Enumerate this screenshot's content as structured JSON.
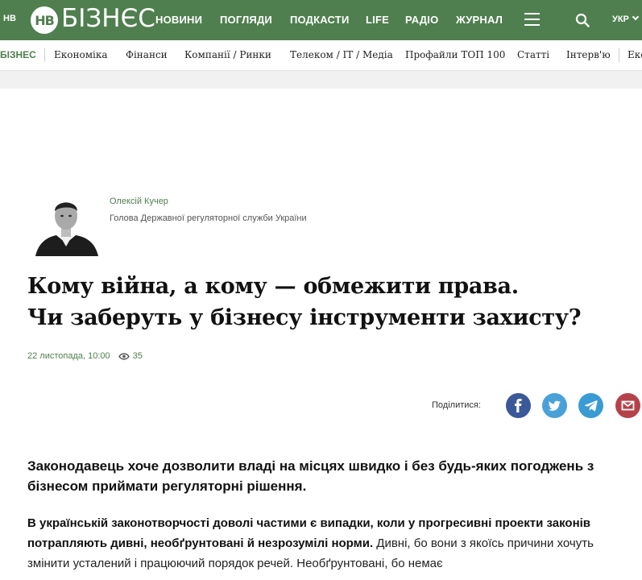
{
  "header": {
    "small_logo": "НВ",
    "logo_mark": "НВ",
    "logo_word": "БІЗНЄС",
    "nav": [
      "НОВИНИ",
      "ПОГЛЯДИ",
      "ПОДКАСТИ",
      "LIFE",
      "РАДІО",
      "ЖУРНАЛ"
    ],
    "lang": "УКР"
  },
  "subnav": {
    "brand": "БІЗНЕС",
    "items": [
      "Економіка",
      "Фінанси",
      "Компанії / Ринки",
      "Телеком / IT / Медіа",
      "Профайли ТОП 100",
      "Статті",
      "Інтерв'ю",
      "Еко"
    ]
  },
  "author": {
    "name": "Олексій Кучер",
    "role": "Голова Державної регуляторної служби України"
  },
  "article": {
    "title_line1": "Кому війна, а кому — обмежити права.",
    "title_line2": "Чи заберуть у бізнесу інструменти захисту?",
    "date": "22 листопада, 10:00",
    "views": "35",
    "share_label": "Поділитися:",
    "lead": "Законодавець хоче дозволити владі на місцях швидко і без будь-яких погоджень з бізнесом приймати регуляторні рішення.",
    "body_bold": "В українській законотворчості доволі частими є випадки, коли у прогресивні проекти законів потрапляють дивні, необґрунтовані й незрозумілі норми.",
    "body_rest": " Дивні, бо вони з якоїсь причини хочуть змінити усталений і працюючий порядок речей. Необґрунтовані, бо немає"
  },
  "share": [
    {
      "name": "facebook",
      "color": "#3b5998"
    },
    {
      "name": "twitter",
      "color": "#4aa1d8"
    },
    {
      "name": "telegram",
      "color": "#3a9bd4"
    },
    {
      "name": "email",
      "color": "#b5424a"
    }
  ],
  "colors": {
    "brand_green": "#4f7f4f"
  }
}
